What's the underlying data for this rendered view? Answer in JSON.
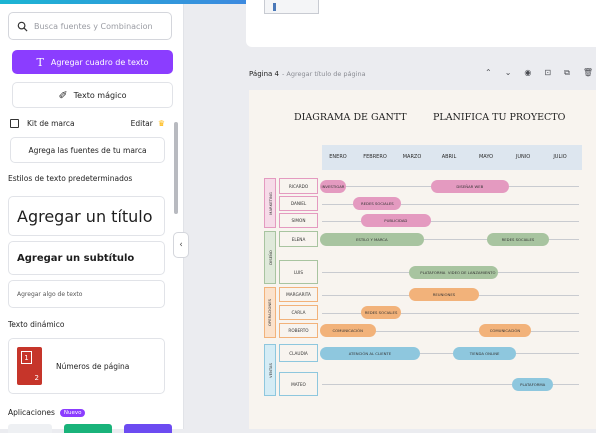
{
  "sidebar": {
    "search_placeholder": "Busca fuentes y Combinacion",
    "add_textbox_label": "Agregar cuadro de texto",
    "magic_text_label": "Texto mágico",
    "brand_kit": {
      "label": "Kit de marca",
      "edit_label": "Editar"
    },
    "add_brand_fonts_label": "Agrega las fuentes de tu marca",
    "default_styles_heading": "Estilos de texto predeterminados",
    "add_title_label": "Agregar un título",
    "add_subtitle_label": "Agregar un subtítulo",
    "add_body_label": "Agregar algo de texto",
    "dynamic_text_heading": "Texto dinámico",
    "page_numbers_label": "Números de página",
    "page_numbers_icon": {
      "a": "1",
      "b": "2"
    },
    "apps_heading": "Aplicaciones",
    "apps_badge": "Nuevo"
  },
  "page_header": {
    "label": "Página 4",
    "title_placeholder": "- Agregar título de página"
  },
  "gantt": {
    "title_left": "DIAGRAMA DE GANTT",
    "title_right": "PLANIFICA TU PROYECTO",
    "months": [
      "ENERO",
      "FEBRERO",
      "MARZO",
      "ABRIL",
      "MAYO",
      "JUNIO",
      "JULIO"
    ],
    "groups": [
      {
        "name": "MARKETING",
        "color": "#e49ac0",
        "fill": "#f6dbe8"
      },
      {
        "name": "DISEÑO",
        "color": "#a8c4a0",
        "fill": "#dfe9da"
      },
      {
        "name": "OPERACIONES",
        "color": "#f2b27a",
        "fill": "#fbe2cc"
      },
      {
        "name": "VENTAS",
        "color": "#8ec7de",
        "fill": "#d5ecf5"
      }
    ],
    "people": [
      "RICARDO",
      "DANIEL",
      "SIMON",
      "ELENA",
      "LUIS",
      "MARGARITA",
      "CARLA",
      "ROBERTO",
      "CLAUDIA",
      "MATEO"
    ],
    "tasks": [
      {
        "person": 0,
        "label": "INVESTIGAR",
        "start": 1.0,
        "end": 1.7,
        "group": 0
      },
      {
        "person": 0,
        "label": "DISEÑAR WEB",
        "start": 4.0,
        "end": 6.1,
        "group": 0
      },
      {
        "person": 1,
        "label": "REDES SOCIALES",
        "start": 1.9,
        "end": 3.2,
        "group": 0
      },
      {
        "person": 2,
        "label": "PUBLICIDAD",
        "start": 2.1,
        "end": 4.0,
        "group": 0
      },
      {
        "person": 3,
        "label": "ESTILO Y MARCA",
        "start": 1.0,
        "end": 3.8,
        "group": 1
      },
      {
        "person": 3,
        "label": "REDES SOCIALES",
        "start": 5.5,
        "end": 7.2,
        "group": 1
      },
      {
        "person": 4,
        "label": "PLATAFORMA",
        "start": 3.4,
        "end": 4.7,
        "group": 1
      },
      {
        "person": 4,
        "label": "VIDEO DE LANZAMIENTO",
        "start": 4.4,
        "end": 5.8,
        "group": 1
      },
      {
        "person": 5,
        "label": "REUNIONES",
        "start": 3.4,
        "end": 5.3,
        "group": 2
      },
      {
        "person": 6,
        "label": "REDES SOCIALES",
        "start": 2.1,
        "end": 3.2,
        "group": 2
      },
      {
        "person": 7,
        "label": "COMUNICACIÓN",
        "start": 1.0,
        "end": 2.5,
        "group": 2
      },
      {
        "person": 7,
        "label": "COMUNICACIÓN",
        "start": 5.3,
        "end": 6.7,
        "group": 2
      },
      {
        "person": 8,
        "label": "ATENCIÓN AL CLIENTE",
        "start": 1.0,
        "end": 3.7,
        "group": 3
      },
      {
        "person": 8,
        "label": "TIENDA ONLINE",
        "start": 4.6,
        "end": 6.3,
        "group": 3
      },
      {
        "person": 9,
        "label": "PLATAFORMA",
        "start": 6.2,
        "end": 7.3,
        "group": 3
      }
    ]
  }
}
